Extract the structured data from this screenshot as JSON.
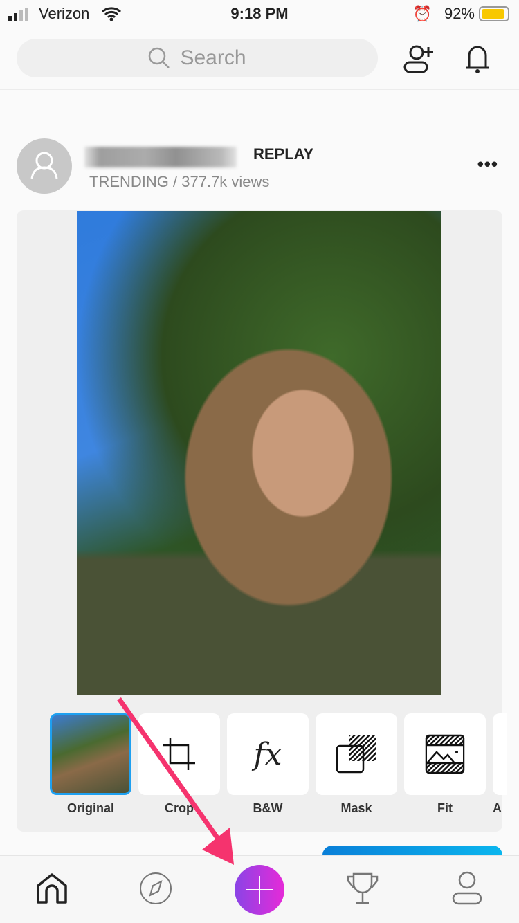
{
  "status_bar": {
    "carrier": "Verizon",
    "time": "9:18 PM",
    "battery": "92%",
    "battery_level": 0.92,
    "battery_color": "#f8c800"
  },
  "header": {
    "search_placeholder": "Search"
  },
  "post": {
    "badge": "REPLAY",
    "meta": "TRENDING / 377.7k views"
  },
  "tools": [
    {
      "label": "Original"
    },
    {
      "label": "Crop"
    },
    {
      "label": "B&W"
    },
    {
      "label": "Mask"
    },
    {
      "label": "Fit"
    },
    {
      "label": "A"
    }
  ],
  "tabbar": {
    "items": [
      "home-icon",
      "compass-icon",
      "plus-icon",
      "trophy-icon",
      "profile-icon"
    ],
    "accent_gradient": [
      "#8a44e6",
      "#e62ad8"
    ]
  },
  "annotation": {
    "arrow_color": "#f5336e"
  }
}
